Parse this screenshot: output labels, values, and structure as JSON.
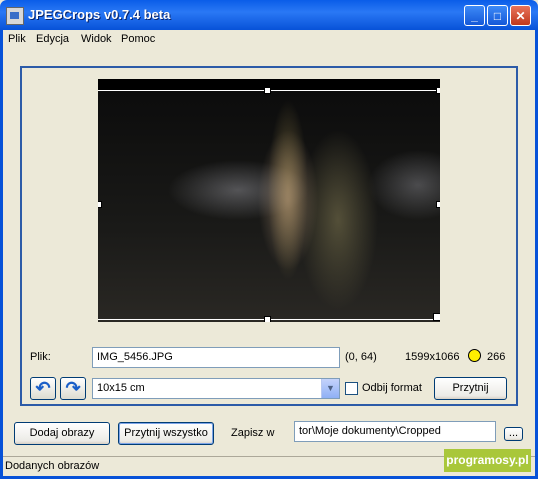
{
  "window": {
    "title": "JPEGCrops v0.7.4 beta",
    "minimize": "_",
    "maximize": "□",
    "close": "✕"
  },
  "menu": [
    {
      "label": "Plik"
    },
    {
      "label": "Edycja"
    },
    {
      "label": "Widok"
    },
    {
      "label": "Pomoc"
    }
  ],
  "image_info": {
    "file_label": "Plik:",
    "filename": "IMG_5456.JPG",
    "offset": "(0, 64)",
    "resolution": "1599x1066",
    "dpi": "266",
    "status_color": "#ffee00"
  },
  "controls": {
    "rotate_left_icon": "rotate-left-icon",
    "rotate_right_icon": "rotate-right-icon",
    "format_value": "10x15 cm",
    "flip_label": "Odbij format",
    "flip_checked": false,
    "crop_button": "Przytnij"
  },
  "bottom": {
    "add_images": "Dodaj obrazy",
    "crop_all": "Przytnij wszystko",
    "save_to_label": "Zapisz w",
    "save_path": "tor\\Moje dokumenty\\Cropped",
    "browse": "..."
  },
  "statusbar": {
    "text": "Dodanych obrazów"
  },
  "watermark": "programosy.pl"
}
